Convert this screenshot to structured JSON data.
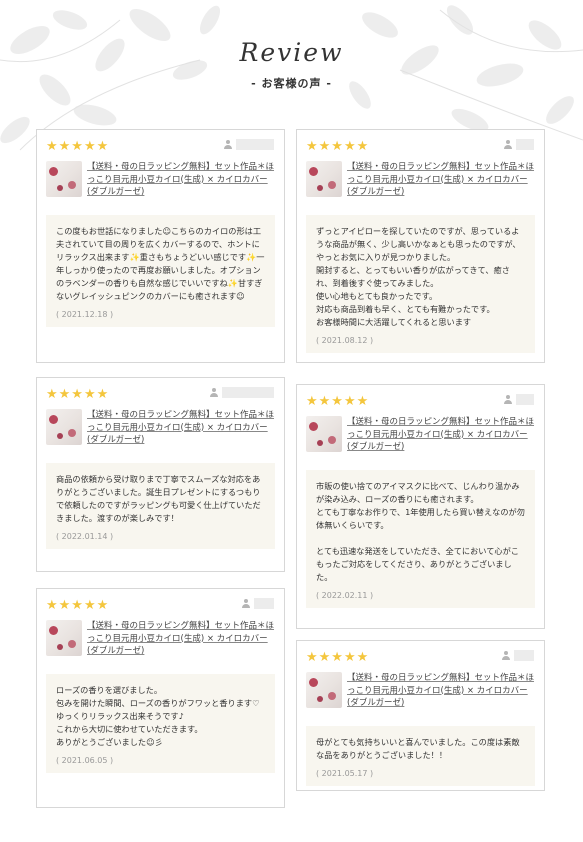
{
  "header": {
    "title": "Review",
    "subtitle": "- お客様の声 -"
  },
  "colors": {
    "star": "#f4c63d",
    "card_border": "#d7d7d7",
    "review_bg": "#f8f6ef",
    "leaf_bg": "#ececec"
  },
  "stars_text": "★★★★★",
  "product_title": "【送料・母の日ラッピング無料】セット作品＊ほっこり目元用小豆カイロ(生成) × カイロカバー(ダブルガーゼ)",
  "reviews_left": [
    {
      "rating": 5,
      "text": "この度もお世話になりました☺︎こちらのカイロの形は工夫されていて目の周りを広くカバーするので、ホントにリラックス出来ます✨重さもちょうどいい感じです✨一年しっかり使ったので再度お願いしました。オプションのラベンダーの香りも自然な感じでいいですね✨甘すぎないグレイッシュピンクのカバーにも癒されます☺︎",
      "date": "( 2021.12.18 )"
    },
    {
      "rating": 5,
      "text": "商品の依頼から受け取りまで丁寧でスムーズな対応をありがとうございました。誕生日プレゼントにするつもりで依頼したのですがラッピングも可愛く仕上げていただきました。渡すのが楽しみです！",
      "date": "( 2022.01.14 )"
    },
    {
      "rating": 5,
      "text": "ローズの香りを選びました。\n包みを開けた瞬間、ローズの香りがフワッと香ります♡\nゆっくりリラックス出来そうです♪\nこれから大切に使わせていただきます。\nありがとうございました☺︎彡",
      "date": "( 2021.06.05 )"
    }
  ],
  "reviews_right": [
    {
      "rating": 5,
      "text": "ずっとアイピローを探していたのですが、思っているような商品が無く、少し高いかなぁとも思ったのですが、やっとお気に入りが見つかりました。\n開封すると、とってもいい香りが広がってきて、癒され、到着後すぐ使ってみました。\n使い心地もとても良かったです。\n対応も商品到着も早く、とても有難かったです。\nお客様時間に大活躍してくれると思います",
      "date": "( 2021.08.12 )"
    },
    {
      "rating": 5,
      "text": "市販の使い捨てのアイマスクに比べて、じんわり温かみが染み込み、ローズの香りにも癒されます。\nとても丁寧なお作りで、1年使用したら買い替えなのが勿体無いくらいです。\n\nとても迅速な発送をしていただき、全てにおいて心がこもったご対応をしてくださり、ありがとうございました。",
      "date": "( 2022.02.11 )"
    },
    {
      "rating": 5,
      "text": "母がとても気持ちいいと喜んでいました。この度は素敵な品をありがとうございました！！",
      "date": "( 2021.05.17 )"
    }
  ]
}
